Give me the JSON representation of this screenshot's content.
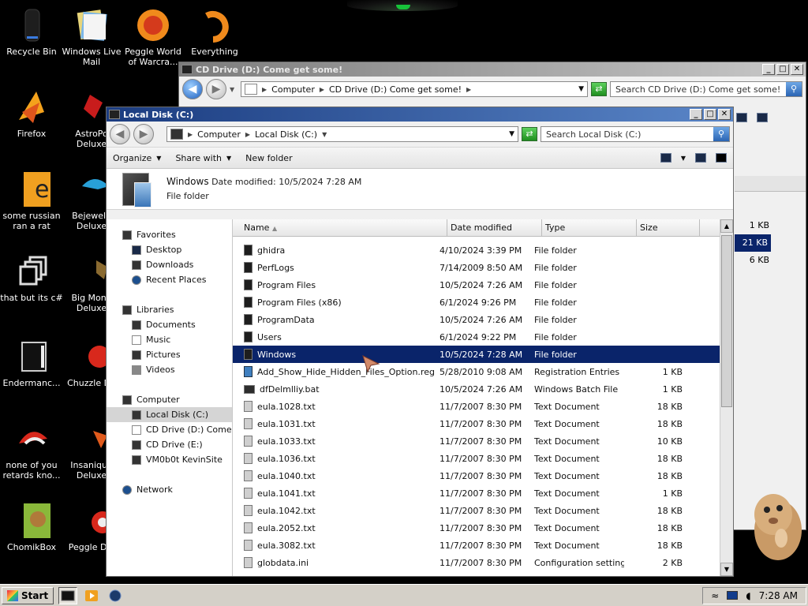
{
  "desktop": {
    "icons": [
      {
        "label": "Recycle Bin"
      },
      {
        "label": "Windows Live Mail"
      },
      {
        "label": "Peggle World of Warcra..."
      },
      {
        "label": "Everything"
      },
      {
        "label": "Firefox"
      },
      {
        "label": "AstroPo Deluxe"
      },
      {
        "label": "some russian ran a rat"
      },
      {
        "label": "Bejewele Deluxe"
      },
      {
        "label": "that but its c#"
      },
      {
        "label": "Big Mone Deluxe"
      },
      {
        "label": "Endermanc..."
      },
      {
        "label": "Chuzzle De"
      },
      {
        "label": "none of you retards kno..."
      },
      {
        "label": "Insaniqua Deluxe"
      },
      {
        "label": "ChomikBox"
      },
      {
        "label": "Peggle Del"
      }
    ]
  },
  "back_window": {
    "title": "CD Drive (D:) Come get some!",
    "crumbs": [
      "Computer",
      "CD Drive (D:) Come get some!"
    ],
    "search_placeholder": "Search CD Drive (D:) Come get some!",
    "sizes": [
      "1 KB",
      "21 KB",
      "6 KB"
    ]
  },
  "front_window": {
    "title": "Local Disk (C:)",
    "crumbs": [
      "Computer",
      "Local Disk (C:)"
    ],
    "search_placeholder": "Search Local Disk (C:)",
    "toolbar": {
      "organize": "Organize",
      "share_with": "Share with",
      "new_folder": "New folder"
    },
    "details": {
      "name": "Windows",
      "modified_label": "Date modified:",
      "modified_value": "10/5/2024 7:28 AM",
      "type": "File folder"
    },
    "nav": {
      "favorites": "Favorites",
      "desktop": "Desktop",
      "downloads": "Downloads",
      "recent": "Recent Places",
      "libraries": "Libraries",
      "documents": "Documents",
      "music": "Music",
      "pictures": "Pictures",
      "videos": "Videos",
      "computer": "Computer",
      "local_disk": "Local Disk (C:)",
      "cd_drive_d": "CD Drive (D:) Come get some!",
      "cd_drive_e": "CD Drive (E:)",
      "vm": "VM0b0t KevinSite",
      "network": "Network"
    },
    "columns": {
      "name": "Name",
      "date": "Date modified",
      "type": "Type",
      "size": "Size"
    },
    "files": [
      {
        "name": "ghidra",
        "date": "4/10/2024 3:39 PM",
        "type": "File folder",
        "size": "",
        "kind": "folder"
      },
      {
        "name": "PerfLogs",
        "date": "7/14/2009 8:50 AM",
        "type": "File folder",
        "size": "",
        "kind": "folder"
      },
      {
        "name": "Program Files",
        "date": "10/5/2024 7:26 AM",
        "type": "File folder",
        "size": "",
        "kind": "folder"
      },
      {
        "name": "Program Files (x86)",
        "date": "6/1/2024 9:26 PM",
        "type": "File folder",
        "size": "",
        "kind": "folder"
      },
      {
        "name": "ProgramData",
        "date": "10/5/2024 7:26 AM",
        "type": "File folder",
        "size": "",
        "kind": "folder"
      },
      {
        "name": "Users",
        "date": "6/1/2024 9:22 PM",
        "type": "File folder",
        "size": "",
        "kind": "folder"
      },
      {
        "name": "Windows",
        "date": "10/5/2024 7:28 AM",
        "type": "File folder",
        "size": "",
        "kind": "folder",
        "selected": true
      },
      {
        "name": "Add_Show_Hide_Hidden_Files_Option.reg",
        "date": "5/28/2010 9:08 AM",
        "type": "Registration Entries",
        "size": "1 KB",
        "kind": "reg"
      },
      {
        "name": "dfDelmlliy.bat",
        "date": "10/5/2024 7:26 AM",
        "type": "Windows Batch File",
        "size": "1 KB",
        "kind": "bat"
      },
      {
        "name": "eula.1028.txt",
        "date": "11/7/2007 8:30 PM",
        "type": "Text Document",
        "size": "18 KB",
        "kind": "doc"
      },
      {
        "name": "eula.1031.txt",
        "date": "11/7/2007 8:30 PM",
        "type": "Text Document",
        "size": "18 KB",
        "kind": "doc"
      },
      {
        "name": "eula.1033.txt",
        "date": "11/7/2007 8:30 PM",
        "type": "Text Document",
        "size": "10 KB",
        "kind": "doc"
      },
      {
        "name": "eula.1036.txt",
        "date": "11/7/2007 8:30 PM",
        "type": "Text Document",
        "size": "18 KB",
        "kind": "doc"
      },
      {
        "name": "eula.1040.txt",
        "date": "11/7/2007 8:30 PM",
        "type": "Text Document",
        "size": "18 KB",
        "kind": "doc"
      },
      {
        "name": "eula.1041.txt",
        "date": "11/7/2007 8:30 PM",
        "type": "Text Document",
        "size": "1 KB",
        "kind": "doc"
      },
      {
        "name": "eula.1042.txt",
        "date": "11/7/2007 8:30 PM",
        "type": "Text Document",
        "size": "18 KB",
        "kind": "doc"
      },
      {
        "name": "eula.2052.txt",
        "date": "11/7/2007 8:30 PM",
        "type": "Text Document",
        "size": "18 KB",
        "kind": "doc"
      },
      {
        "name": "eula.3082.txt",
        "date": "11/7/2007 8:30 PM",
        "type": "Text Document",
        "size": "18 KB",
        "kind": "doc"
      },
      {
        "name": "globdata.ini",
        "date": "11/7/2007 8:30 PM",
        "type": "Configuration settings",
        "size": "2 KB",
        "kind": "doc"
      }
    ]
  },
  "taskbar": {
    "start_label": "Start",
    "clock": "7:28 AM"
  },
  "colors": {
    "selection": "#0a246a",
    "title_active": "#1b3c80",
    "desktop": "#000000"
  }
}
